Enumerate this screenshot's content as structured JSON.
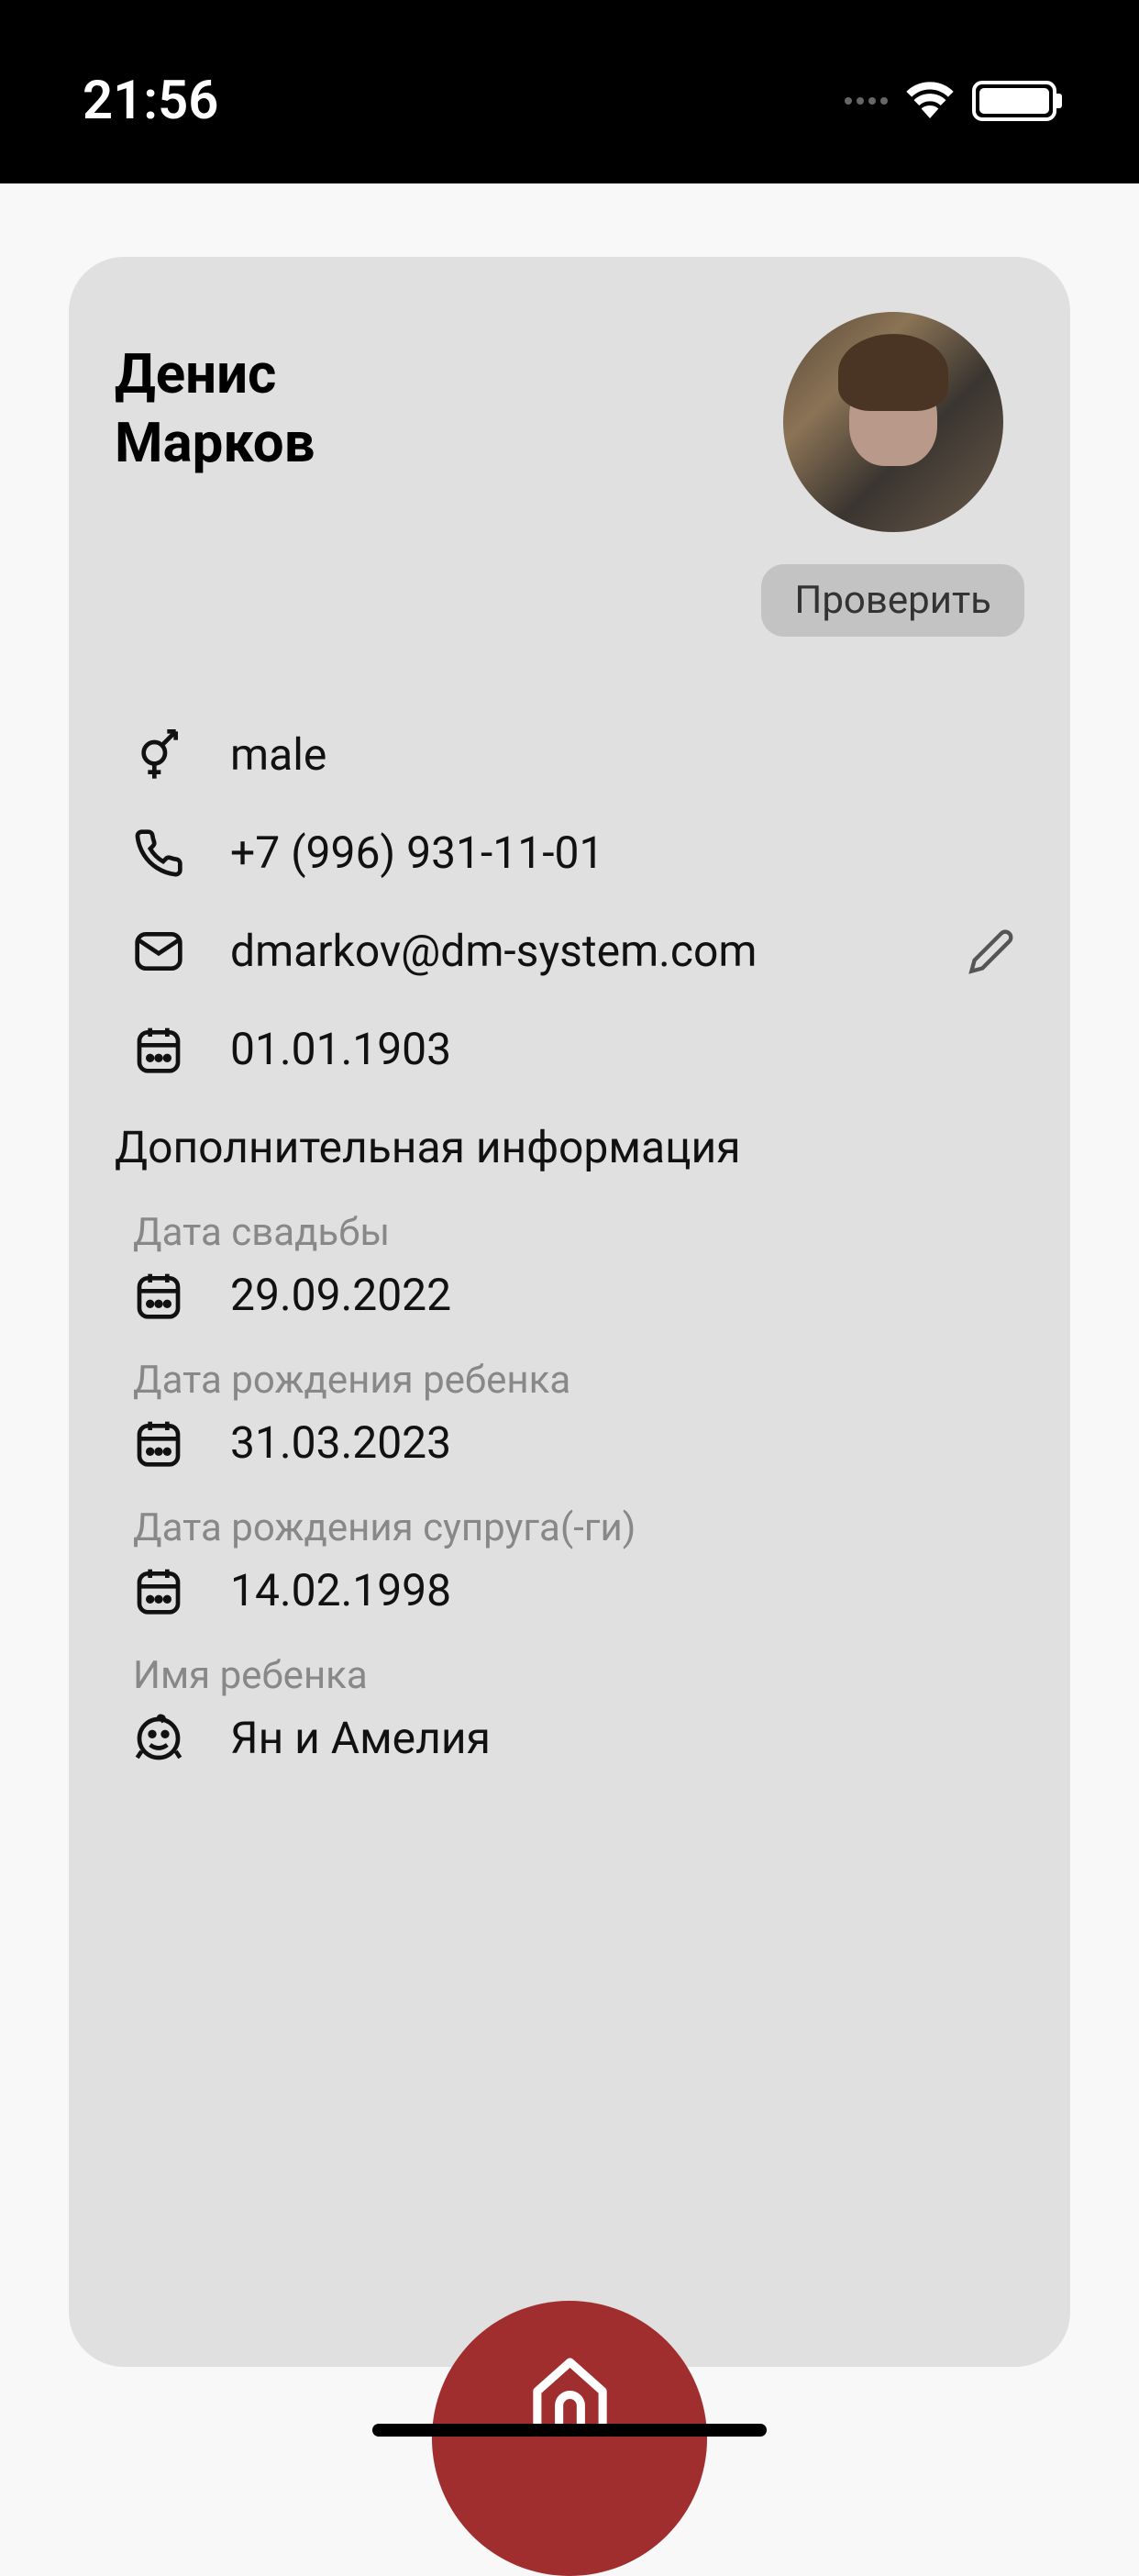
{
  "statusBar": {
    "time": "21:56"
  },
  "profile": {
    "firstName": "Денис",
    "lastName": "Марков",
    "verifyButton": "Проверить",
    "gender": "male",
    "phone": "+7 (996) 931-11-01",
    "email": "dmarkov@dm-system.com",
    "birthDate": "01.01.1903"
  },
  "additional": {
    "title": "Дополнительная информация",
    "weddingLabel": "Дата свадьбы",
    "weddingDate": "29.09.2022",
    "childBirthLabel": "Дата рождения ребенка",
    "childBirthDate": "31.03.2023",
    "spouseBirthLabel": "Дата рождения супруга(-ги)",
    "spouseBirthDate": "14.02.1998",
    "childNameLabel": "Имя ребенка",
    "childName": "Ян и Амелия"
  }
}
